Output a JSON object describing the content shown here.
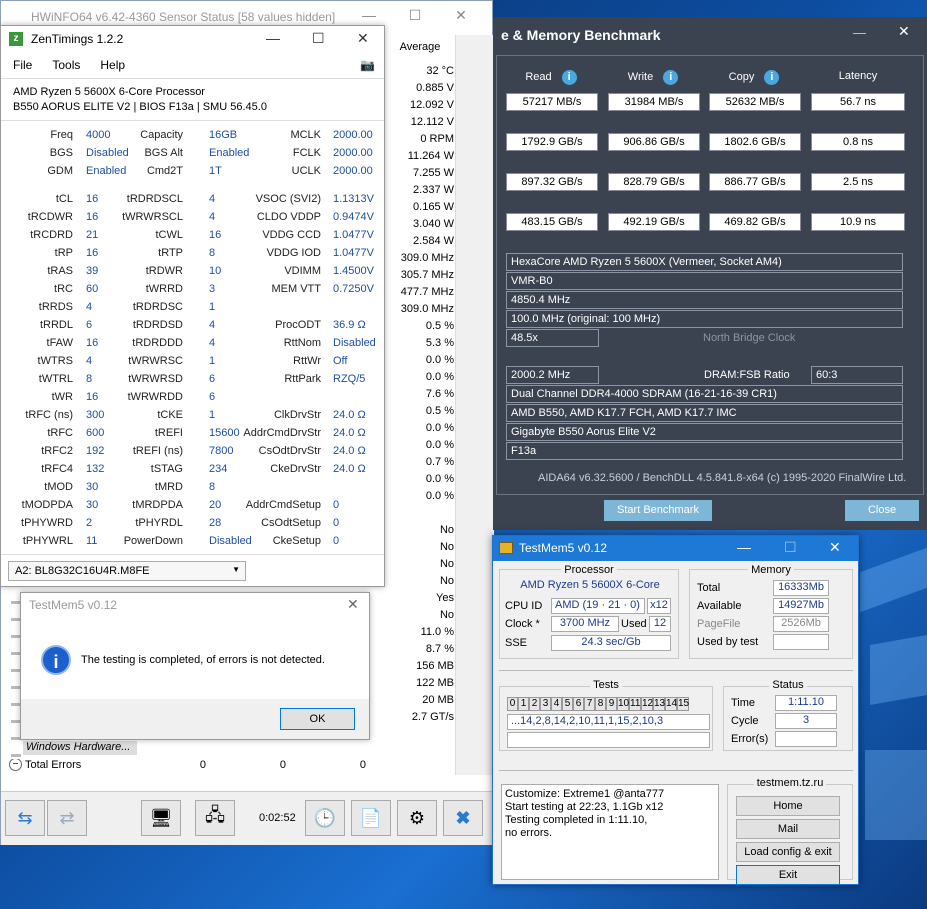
{
  "hwinfo": {
    "title": "HWiNFO64 v6.42-4360 Sensor Status [58 values hidden]",
    "col_average": "Average",
    "averages": [
      "32 °C",
      "0.885 V",
      "12.092 V",
      "12.112 V",
      "0 RPM",
      "11.264 W",
      "7.255 W",
      "2.337 W",
      "0.165 W",
      "3.040 W",
      "2.584 W",
      "309.0 MHz",
      "305.7 MHz",
      "477.7 MHz",
      "309.0 MHz",
      "0.5 %",
      "5.3 %",
      "0.0 %",
      "0.0 %",
      "7.6 %",
      "0.5 %",
      "0.0 %",
      "0.0 %",
      "0.7 %",
      "0.0 %",
      "0.0 %",
      "No",
      "No",
      "No",
      "No",
      "Yes",
      "No",
      "11.0 %",
      "8.7 %",
      "156 MB",
      "122 MB",
      "20 MB",
      "2.7 GT/s"
    ],
    "group_label": "Windows Hardware...",
    "total_errors_label": "Total Errors",
    "total_errors_values": [
      "0",
      "0",
      "0"
    ],
    "timer": "0:02:52"
  },
  "zen": {
    "title": "ZenTimings 1.2.2",
    "menu": [
      "File",
      "Tools",
      "Help"
    ],
    "cpu": "AMD Ryzen 5 5600X 6-Core Processor",
    "board": "B550 AORUS ELITE V2 | BIOS F13a | SMU 56.45.0",
    "rows": [
      [
        "Freq",
        "4000",
        "Capacity",
        "16GB",
        "MCLK",
        "2000.00"
      ],
      [
        "BGS",
        "Disabled",
        "BGS Alt",
        "Enabled",
        "FCLK",
        "2000.00"
      ],
      [
        "GDM",
        "Enabled",
        "Cmd2T",
        "1T",
        "UCLK",
        "2000.00"
      ],
      [
        "tCL",
        "16",
        "tRDRDSCL",
        "4",
        "VSOC (SVI2)",
        "1.1313V"
      ],
      [
        "tRCDWR",
        "16",
        "tWRWRSCL",
        "4",
        "CLDO VDDP",
        "0.9474V"
      ],
      [
        "tRCDRD",
        "21",
        "tCWL",
        "16",
        "VDDG CCD",
        "1.0477V"
      ],
      [
        "tRP",
        "16",
        "tRTP",
        "8",
        "VDDG IOD",
        "1.0477V"
      ],
      [
        "tRAS",
        "39",
        "tRDWR",
        "10",
        "VDIMM",
        "1.4500V"
      ],
      [
        "tRC",
        "60",
        "tWRRD",
        "3",
        "MEM VTT",
        "0.7250V"
      ],
      [
        "tRRDS",
        "4",
        "tRDRDSC",
        "1",
        "",
        ""
      ],
      [
        "tRRDL",
        "6",
        "tRDRDSD",
        "4",
        "ProcODT",
        "36.9 Ω"
      ],
      [
        "tFAW",
        "16",
        "tRDRDDD",
        "4",
        "RttNom",
        "Disabled"
      ],
      [
        "tWTRS",
        "4",
        "tWRWRSC",
        "1",
        "RttWr",
        "Off"
      ],
      [
        "tWTRL",
        "8",
        "tWRWRSD",
        "6",
        "RttPark",
        "RZQ/5"
      ],
      [
        "tWR",
        "16",
        "tWRWRDD",
        "6",
        "",
        ""
      ],
      [
        "tRFC (ns)",
        "300",
        "tCKE",
        "1",
        "ClkDrvStr",
        "24.0 Ω"
      ],
      [
        "tRFC",
        "600",
        "tREFI",
        "15600",
        "AddrCmdDrvStr",
        "24.0 Ω"
      ],
      [
        "tRFC2",
        "192",
        "tREFI (ns)",
        "7800",
        "CsOdtDrvStr",
        "24.0 Ω"
      ],
      [
        "tRFC4",
        "132",
        "tSTAG",
        "234",
        "CkeDrvStr",
        "24.0 Ω"
      ],
      [
        "tMOD",
        "30",
        "tMRD",
        "8",
        "",
        ""
      ],
      [
        "tMODPDA",
        "30",
        "tMRDPDA",
        "20",
        "AddrCmdSetup",
        "0"
      ],
      [
        "tPHYWRD",
        "2",
        "tPHYRDL",
        "28",
        "CsOdtSetup",
        "0"
      ],
      [
        "tPHYWRL",
        "11",
        "PowerDown",
        "Disabled",
        "CkeSetup",
        "0"
      ]
    ],
    "module": "A2: BL8G32C16U4R.M8FE"
  },
  "aida": {
    "title": "e & Memory Benchmark",
    "headers": [
      "Read",
      "Write",
      "Copy",
      "Latency"
    ],
    "results": [
      [
        "57217 MB/s",
        "31984 MB/s",
        "52632 MB/s",
        "56.7 ns"
      ],
      [
        "1792.9 GB/s",
        "906.86 GB/s",
        "1802.6 GB/s",
        "0.8 ns"
      ],
      [
        "897.32 GB/s",
        "828.79 GB/s",
        "886.77 GB/s",
        "2.5 ns"
      ],
      [
        "483.15 GB/s",
        "492.19 GB/s",
        "469.82 GB/s",
        "10.9 ns"
      ]
    ],
    "cpu_type": "HexaCore AMD Ryzen 5 5600X  (Vermeer, Socket AM4)",
    "stepping": "VMR-B0",
    "cpu_clock": "4850.4 MHz",
    "fsb": "100.0 MHz  (original: 100 MHz)",
    "multiplier": "48.5x",
    "nb_clock_label": "North Bridge Clock",
    "mem_clock": "2000.2 MHz",
    "dram_fsb_label": "DRAM:FSB Ratio",
    "dram_fsb": "60:3",
    "mem_type": "Dual Channel DDR4-4000 SDRAM  (16-21-16-39 CR1)",
    "chipset": "AMD B550, AMD K17.7 FCH, AMD K17.7 IMC",
    "motherboard": "Gigabyte B550 Aorus Elite V2",
    "bios": "F13a",
    "footer": "AIDA64 v6.32.5600 / BenchDLL 4.5.841.8-x64  (c) 1995-2020 FinalWire Ltd.",
    "start_btn": "Start Benchmark",
    "close_btn": "Close"
  },
  "tm_dialog": {
    "title": "TestMem5 v0.12",
    "message": "The testing is completed, of errors is not detected.",
    "ok": "OK"
  },
  "testmem": {
    "title": "TestMem5 v0.12",
    "processor_label": "Processor",
    "cpu_name": "AMD Ryzen 5 5600X 6-Core",
    "cpu_id_label": "CPU ID",
    "cpu_id": "AMD  (19 · 21 · 0)",
    "threads": "x12",
    "clock_label": "Clock *",
    "clock": "3700 MHz",
    "used_label": "Used",
    "used": "12",
    "sse_label": "SSE",
    "sse": "24.3 sec/Gb",
    "memory_label": "Memory",
    "total_label": "Total",
    "total": "16333Mb",
    "available_label": "Available",
    "available": "14927Mb",
    "pagefile_label": "PageFile",
    "pagefile": "2526Mb",
    "usedbytest_label": "Used by test",
    "tests_label": "Tests",
    "test_cells": [
      "0",
      "1",
      "2",
      "3",
      "4",
      "5",
      "6",
      "7",
      "8",
      "9",
      "10",
      "11",
      "12",
      "13",
      "14",
      "15"
    ],
    "sequence": "...14,2,8,14,2,10,11,1,15,2,10,3",
    "status_label": "Status",
    "time_label": "Time",
    "time": "1:11.10",
    "cycle_label": "Cycle",
    "cycle": "3",
    "errors_label": "Error(s)",
    "log": [
      "Customize: Extreme1 @anta777",
      "Start testing at 22:23, 1.1Gb x12",
      "Testing completed in 1:11.10,",
      "no errors."
    ],
    "site_label": "testmem.tz.ru",
    "btn_home": "Home",
    "btn_mail": "Mail",
    "btn_load": "Load config & exit",
    "btn_exit": "Exit"
  }
}
